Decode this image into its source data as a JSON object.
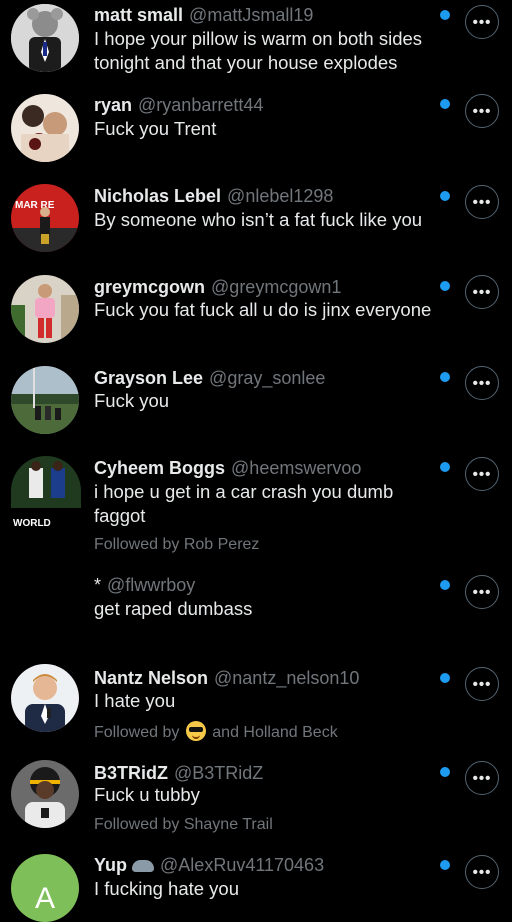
{
  "ui": {
    "accent": "#1d9bf0",
    "more_icon": "more-horizontal-icon"
  },
  "replies": [
    {
      "name": "matt small",
      "handle": "@mattJsmall19",
      "text": "I hope your pillow is warm on both sides tonight and that your house explodes",
      "followed_by": ""
    },
    {
      "name": "ryan",
      "handle": "@ryanbarrett44",
      "text": "Fuck you Trent",
      "followed_by": ""
    },
    {
      "name": "Nicholas Lebel",
      "handle": "@nlebel1298",
      "text": "By someone who isn’t a fat fuck like you",
      "followed_by": "",
      "avatar_text": "MAR  RE"
    },
    {
      "name": "greymcgown",
      "handle": "@greymcgown1",
      "text": "Fuck you fat fuck all u do is jinx everyone",
      "followed_by": ""
    },
    {
      "name": "Grayson Lee",
      "handle": "@gray_sonlee",
      "text": "Fuck you",
      "followed_by": ""
    },
    {
      "name": "Cyheem Boggs",
      "handle": "@heemswervoo",
      "text": "i hope u get in a car crash you dumb faggot",
      "followed_by": "Followed by Rob Perez",
      "avatar_text": "WORLD"
    },
    {
      "name": "*",
      "handle": "@flwwrboy",
      "text": "get raped dumbass",
      "followed_by": ""
    },
    {
      "name": "Nantz Nelson",
      "handle": "@nantz_nelson10",
      "text": "I hate you",
      "followed_by_prefix": "Followed by",
      "followed_by_suffix": "and Holland Beck"
    },
    {
      "name": "B3TRidZ",
      "handle": "@B3TRidZ",
      "text": "Fuck u tubby",
      "followed_by": "Followed by Shayne Trail"
    },
    {
      "name": "Yup",
      "handle": "@AlexRuv41170463",
      "text": "I fucking hate you",
      "followed_by": "",
      "avatar_letter": "A"
    }
  ]
}
